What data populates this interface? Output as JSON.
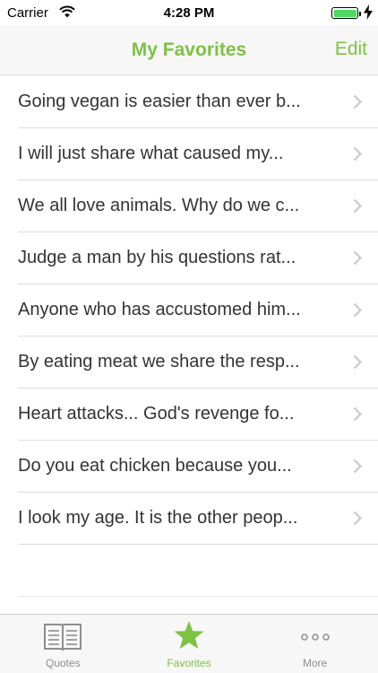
{
  "status_bar": {
    "carrier": "Carrier",
    "time": "4:28 PM",
    "battery_color": "#4cd964"
  },
  "nav": {
    "title": "My Favorites",
    "edit_label": "Edit",
    "accent_color": "#7dc242"
  },
  "favorites": [
    "Going vegan is easier than ever b...",
    "I will just share what caused my...",
    "We all love animals. Why do we c...",
    "Judge a man by his questions rat...",
    "Anyone who has accustomed him...",
    "By eating meat we share the resp...",
    "Heart attacks... God's revenge fo...",
    "Do you eat chicken because you...",
    "I look my age. It is the other peop..."
  ],
  "tabs": [
    {
      "label": "Quotes",
      "icon": "book-icon",
      "active": false
    },
    {
      "label": "Favorites",
      "icon": "star-icon",
      "active": true
    },
    {
      "label": "More",
      "icon": "more-dots-icon",
      "active": false
    }
  ]
}
